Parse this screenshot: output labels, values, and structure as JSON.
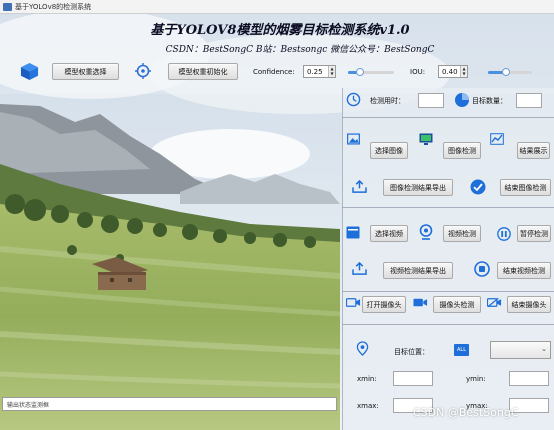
{
  "window": {
    "title": "基于YOLOv8的检测系统"
  },
  "header": {
    "title": "基于YOLOV8模型的烟雾目标检测系统v1.0",
    "subtitle": "CSDN：BestSongC   B站：Bestsongc   微信公众号：BestSongC"
  },
  "toolbar": {
    "model_select_label": "模型权重选择",
    "model_init_label": "模型权重初始化",
    "confidence_label": "Confidence:",
    "confidence_value": "0.25",
    "confidence_level": 0.25,
    "iou_label": "IOU:",
    "iou_value": "0.40",
    "iou_level": 0.4
  },
  "stats": {
    "time_label": "检测用时：",
    "count_label": "目标数量："
  },
  "image_panel": {
    "select_image": "选择图像",
    "detect_image": "图像检测",
    "show_result": "结果展示",
    "export_image": "图像检测结果导出",
    "end_image": "结束图像检测"
  },
  "video_panel": {
    "select_video": "选择视频",
    "detect_video": "视频检测",
    "pause_detect": "暂停检测",
    "export_video": "视频检测结果导出",
    "end_video": "结束视频检测"
  },
  "camera_panel": {
    "open_camera": "打开摄像头",
    "detect_camera": "摄像头检测",
    "end_camera": "结束摄像头"
  },
  "target_panel": {
    "position_label": "目标位置：",
    "all_badge": "ALL",
    "xmin": "xmin:",
    "ymin": "ymin:",
    "xmax": "xmax:",
    "ymax": "ymax:"
  },
  "status": {
    "placeholder": "输出状态监测框"
  },
  "watermark": "CSDN @BestSongC",
  "colors": {
    "accent": "#1e6fd9",
    "slider": "#4a90e2"
  }
}
